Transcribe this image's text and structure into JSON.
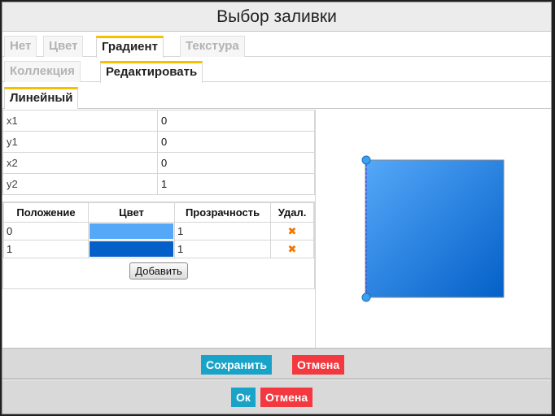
{
  "dialog": {
    "title": "Выбор заливки"
  },
  "tabs_fill": [
    {
      "label": "Нет",
      "active": false
    },
    {
      "label": "Цвет",
      "active": false
    },
    {
      "label": "Градиент",
      "active": true
    },
    {
      "label": "Текстура",
      "active": false
    }
  ],
  "tabs_gradient": [
    {
      "label": "Коллекция",
      "active": false
    },
    {
      "label": "Редактировать",
      "active": true
    }
  ],
  "tabs_type": [
    {
      "label": "Линейный",
      "active": true
    }
  ],
  "coords": [
    {
      "key": "x1",
      "value": "0"
    },
    {
      "key": "y1",
      "value": "0"
    },
    {
      "key": "x2",
      "value": "0"
    },
    {
      "key": "y2",
      "value": "1"
    }
  ],
  "stops": {
    "headers": {
      "position": "Положение",
      "color": "Цвет",
      "opacity": "Прозрачность",
      "delete": "Удал."
    },
    "rows": [
      {
        "position": "0",
        "color": "#55a8f8",
        "opacity": "1"
      },
      {
        "position": "1",
        "color": "#0460c8",
        "opacity": "1"
      }
    ],
    "add_label": "Добавить"
  },
  "preview": {
    "color_start": "#55a8f8",
    "color_end": "#0460c8",
    "handle_color": "#3aa0f0"
  },
  "footer1": {
    "save_label": "Сохранить",
    "cancel_label": "Отмена"
  },
  "footer2": {
    "ok_label": "Ок",
    "cancel_label": "Отмена"
  },
  "icons": {
    "delete": "close-x-icon"
  }
}
